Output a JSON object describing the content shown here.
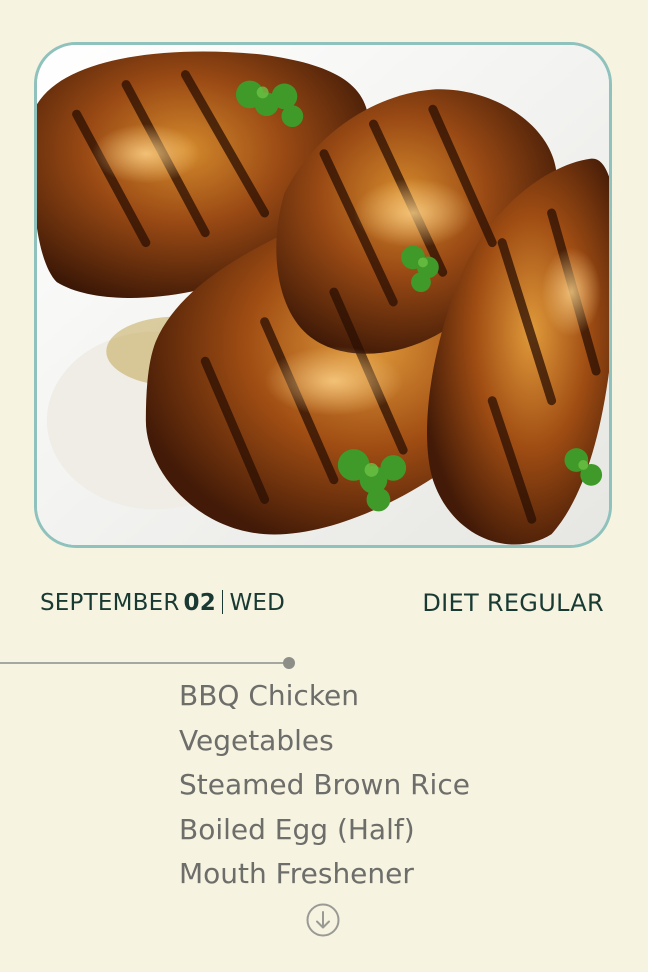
{
  "meal_image": {
    "alt": "BBQ chicken"
  },
  "date": {
    "month": "SEPTEMBER",
    "day": "02",
    "weekday": "WED"
  },
  "diet": {
    "label": "DIET REGULAR"
  },
  "menu": {
    "items": [
      "BBQ Chicken",
      "Vegetables",
      "Steamed Brown Rice",
      "Boiled Egg (Half)",
      "Mouth Freshener"
    ]
  },
  "icons": {
    "scroll": "arrow-down-circle-icon",
    "photo": "meal-photo"
  },
  "colors": {
    "background": "#f6f3e1",
    "text_dark": "#183a33",
    "text_muted": "#6d6d6a",
    "card_border": "#8fc2bd"
  }
}
